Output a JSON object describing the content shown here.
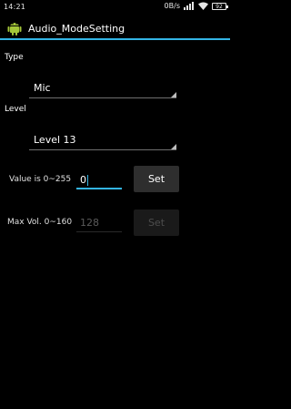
{
  "status_bar": {
    "time": "14:21",
    "network_speed": "0B/s",
    "battery_level": "92"
  },
  "action_bar": {
    "title": "Audio_ModeSetting"
  },
  "form": {
    "type_label": "Type",
    "type_selected": "Mic",
    "level_label": "Level",
    "level_selected": "Level 13",
    "value_label": "Value is 0~255",
    "value_input": "0",
    "value_set_button": "Set",
    "maxvol_label": "Max Vol. 0~160",
    "maxvol_input": "128",
    "maxvol_set_button": "Set"
  },
  "colors": {
    "accent": "#33b5e5",
    "button_enabled": "#2e2e2e",
    "button_disabled": "#1a1a1a"
  }
}
